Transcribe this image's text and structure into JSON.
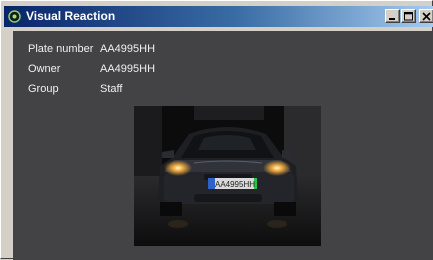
{
  "window": {
    "title": "Visual Reaction",
    "icons": {
      "app": "app-icon",
      "minimize": "minimize-icon",
      "maximize": "maximize-icon",
      "close": "close-icon"
    }
  },
  "info": {
    "plate_label": "Plate number",
    "plate_value": "AA4995HH",
    "owner_label": "Owner",
    "owner_value": "AA4995HH",
    "group_label": "Group",
    "group_value": "Staff"
  },
  "photo": {
    "plate_text": "AA4995HH"
  },
  "colors": {
    "client_bg": "#434345",
    "title_start": "#0a246a",
    "title_end": "#a6caf0",
    "text": "#f0f0f0"
  }
}
